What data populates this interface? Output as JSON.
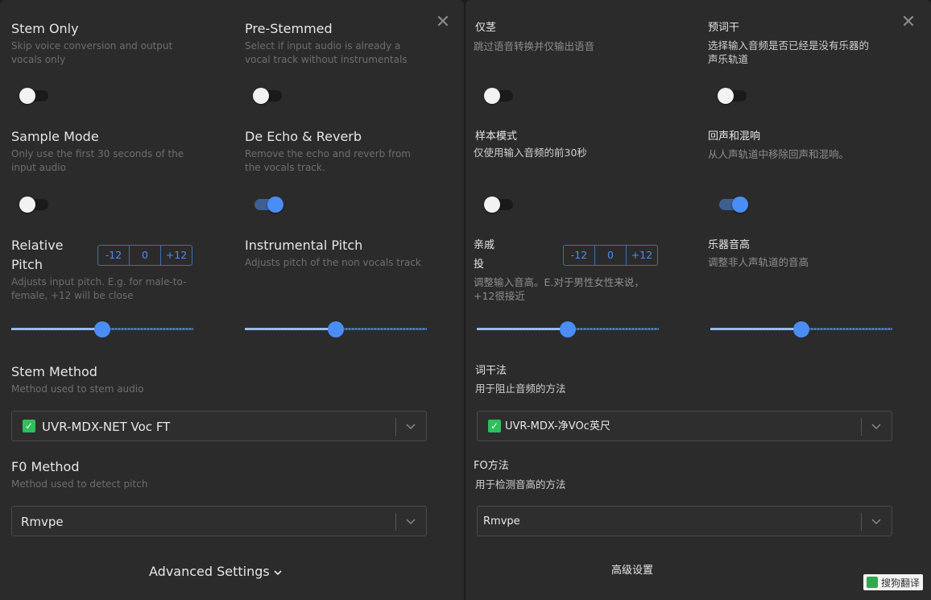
{
  "left": {
    "stem_only": {
      "title": "Stem Only",
      "desc": "Skip voice conversion and output vocals only"
    },
    "pre_stemmed": {
      "title": "Pre-Stemmed",
      "desc": "Select if input audio is already a vocal track without instrumentals"
    },
    "sample_mode": {
      "title": "Sample Mode",
      "desc": "Only use the first 30 seconds of the input audio"
    },
    "de_echo": {
      "title": "De Echo & Reverb",
      "desc": "Remove the echo and reverb from the vocals track."
    },
    "relative_pitch": {
      "title_line1": "Relative",
      "title_line2": "Pitch",
      "desc": "Adjusts input pitch. E.g. for male-to-female, +12 will be close",
      "minus": "-12",
      "zero": "0",
      "plus": "+12"
    },
    "instrumental_pitch": {
      "title": "Instrumental Pitch",
      "desc": "Adjusts pitch of the non vocals track"
    },
    "stem_method": {
      "title": "Stem Method",
      "desc": "Method used to stem audio",
      "value": "UVR-MDX-NET Voc FT"
    },
    "f0_method": {
      "title": "F0 Method",
      "desc": "Method used to detect pitch",
      "value": "Rmvpe"
    },
    "advanced": "Advanced Settings"
  },
  "right": {
    "stem_only": {
      "title": "仅茎",
      "desc": "跳过语音转换并仅输出语音"
    },
    "pre_stemmed": {
      "title": "预词干",
      "desc": "选择输入音频是否已经是没有乐器的声乐轨道"
    },
    "sample_mode": {
      "title": "样本模式",
      "desc": "仅使用输入音频的前30秒"
    },
    "de_echo": {
      "title": "回声和混响",
      "desc": "从人声轨道中移除回声和混响。"
    },
    "relative_pitch": {
      "title_line1": "亲戚",
      "title_line2": "投",
      "desc": "调整输入音高。E.对于男性女性来说，+12很接近",
      "minus": "-12",
      "zero": "0",
      "plus": "+12"
    },
    "instrumental_pitch": {
      "title": "乐器音高",
      "desc": "调整非人声轨道的音高"
    },
    "stem_method": {
      "title": "词干法",
      "desc": "用于阻止音频的方法",
      "value": "UVR-MDX-净VOc英尺"
    },
    "f0_method": {
      "title": "FO方法",
      "desc": "用于检测音高的方法",
      "value": "Rmvpe"
    },
    "advanced": "高级设置"
  },
  "toggles": {
    "stem_only": false,
    "pre_stemmed": false,
    "sample_mode": false,
    "de_echo": true
  },
  "sliders": {
    "relative_pitch": 0,
    "instrumental_pitch": 0,
    "min": -12,
    "max": 12
  },
  "watermark": "搜狗翻译",
  "colors": {
    "accent": "#4a8ef5",
    "check": "#2fbf5b",
    "panel": "#2b2b2b"
  },
  "icons": {
    "close": "close-icon",
    "chevron": "chevron-down-icon",
    "check": "check-icon"
  }
}
